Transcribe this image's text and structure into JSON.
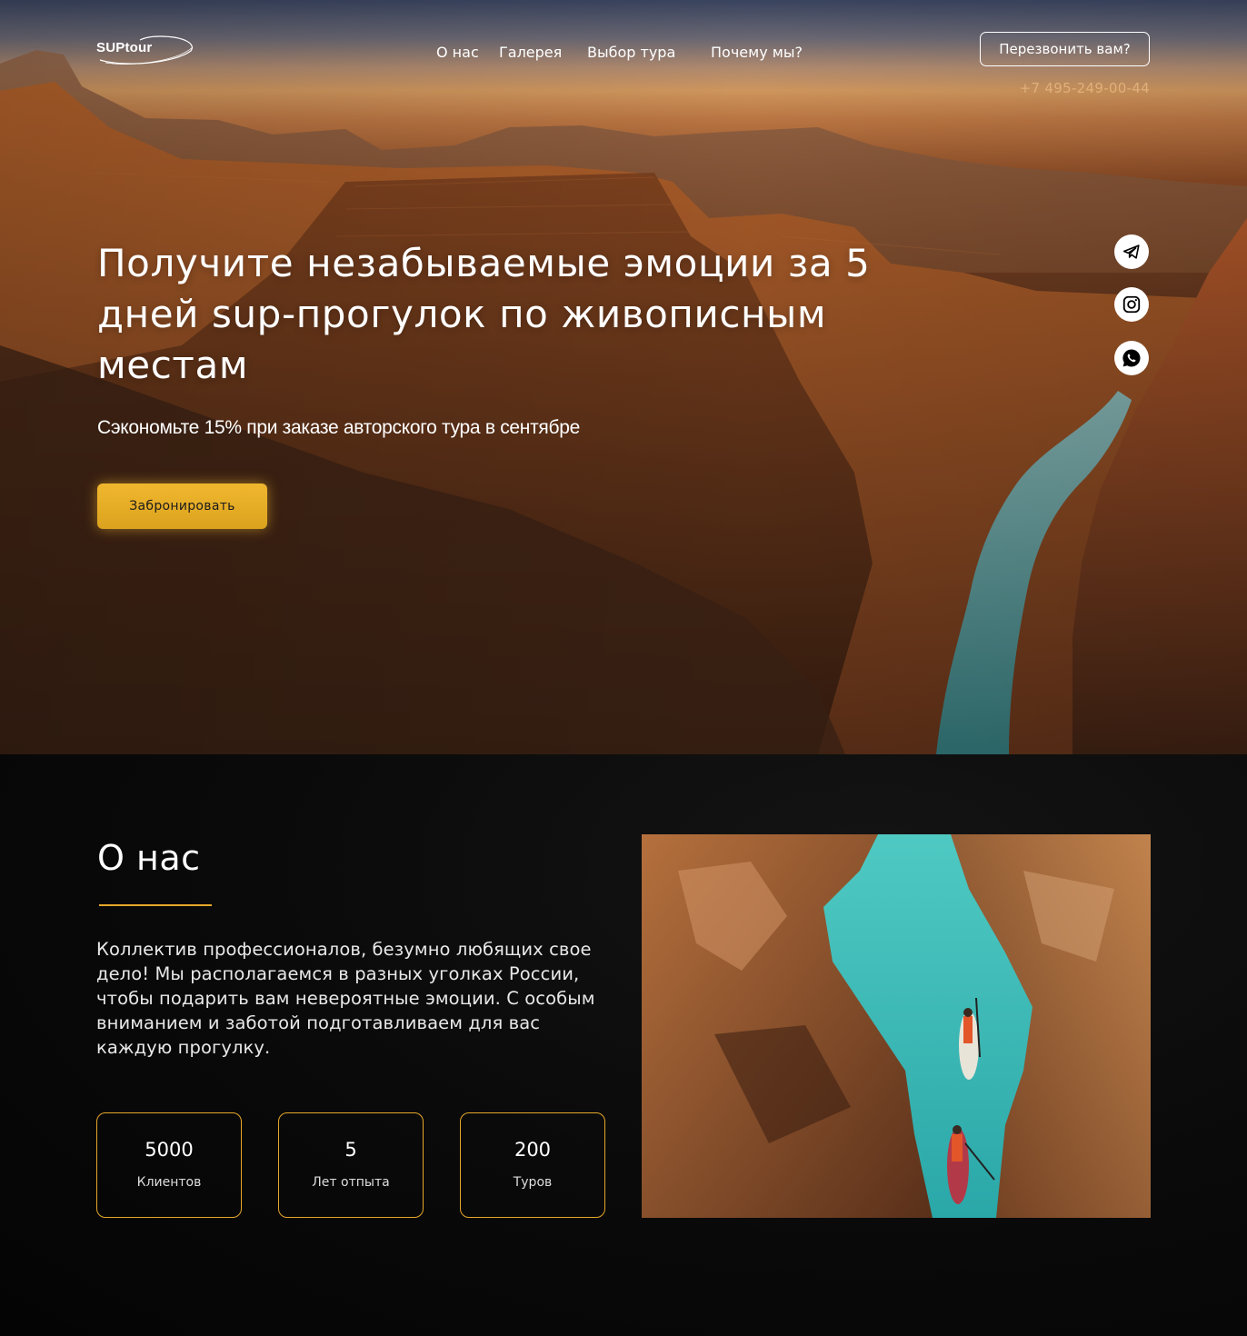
{
  "header": {
    "logo_text": "SUPtour",
    "nav": [
      {
        "label": "О нас"
      },
      {
        "label": "Галерея"
      },
      {
        "label": "Выбор тура"
      },
      {
        "label": "Почему мы?"
      }
    ],
    "callback_label": "Перезвонить вам?",
    "phone": "+7 495-249-00-44"
  },
  "hero": {
    "title": "Получите незабываемые эмоции за 5 дней sup-прогулок по живописным местам",
    "subtitle": "Сэкономьте 15% при заказе авторского тура в сентябре",
    "book_label": "Забронировать",
    "socials": [
      "telegram-icon",
      "instagram-icon",
      "whatsapp-icon"
    ]
  },
  "about": {
    "title": "О нас",
    "text": "Коллектив профессионалов, безумно любящих свое дело! Мы располагаемся в разных уголках России, чтобы подарить вам невероятные эмоции. С особым вниманием и заботой подготавливаем для вас каждую прогулку.",
    "stats": [
      {
        "value": "5000",
        "label": "Клиентов"
      },
      {
        "value": "5",
        "label": "Лет отпыта"
      },
      {
        "value": "200",
        "label": "Туров"
      }
    ]
  },
  "colors": {
    "accent": "#e6a72a",
    "button": "#f0b72e",
    "dark_bg": "#050505"
  }
}
